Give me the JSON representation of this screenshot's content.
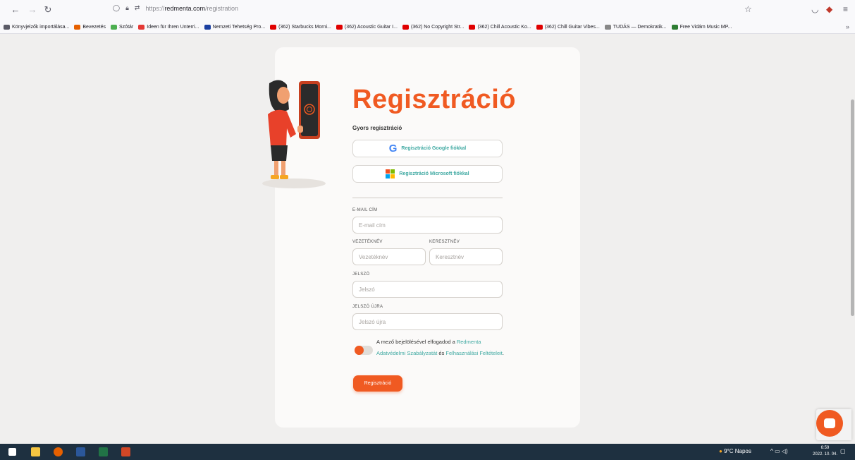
{
  "browser": {
    "url_prefix": "https://",
    "url_host": "redmenta.com",
    "url_path": "/registration",
    "bookmarks": [
      {
        "label": "Könyvjelzők importálása...",
        "color": "#5b5b66"
      },
      {
        "label": "Bevezetés",
        "color": "#e66000"
      },
      {
        "label": "Szótár",
        "color": "#4caf50"
      },
      {
        "label": "Ideen für Ihren Unterri...",
        "color": "#e53935"
      },
      {
        "label": "Nemzeti Tehetség Pro...",
        "color": "#1a3fa0"
      },
      {
        "label": "(362) Starbucks Morni...",
        "color": "#e00000"
      },
      {
        "label": "(362) Acoustic Guitar I...",
        "color": "#e00000"
      },
      {
        "label": "(362) No Copyright Str...",
        "color": "#e00000"
      },
      {
        "label": "(362) Chill Acoustic Ko...",
        "color": "#e00000"
      },
      {
        "label": "(362) Chill Guitar Vibes...",
        "color": "#e00000"
      },
      {
        "label": "TUDÁS — Demokratik...",
        "color": "#888888"
      },
      {
        "label": "Free Vidám Music MP...",
        "color": "#2e7d32"
      }
    ]
  },
  "form": {
    "title": "Regisztráció",
    "subtitle": "Gyors regisztráció",
    "google_button": "Regisztráció Google fiókkal",
    "microsoft_button": "Regisztráció Microsoft fiókkal",
    "email_label": "E-MAIL CÍM",
    "email_placeholder": "E-mail cím",
    "lastname_label": "VEZETÉKNÉV",
    "lastname_placeholder": "Vezetéknév",
    "firstname_label": "KERESZTNÉV",
    "firstname_placeholder": "Keresztnév",
    "password_label": "JELSZÓ",
    "password_placeholder": "Jelszó",
    "password2_label": "JELSZÓ ÚJRA",
    "password2_placeholder": "Jelszó újra",
    "consent_pre": "A mező bejelölésével elfogadod a ",
    "consent_link1": "Redmenta Adatvédelmi Szabályzatát",
    "consent_mid": " és ",
    "consent_link2": "Felhasználási Feltételeit",
    "consent_post": ".",
    "submit": "Regisztráció"
  },
  "taskbar": {
    "weather": "9°C  Napos",
    "time": "6:59",
    "date": "2022. 10. 04."
  },
  "colors": {
    "accent": "#f05a22",
    "link": "#3fa9a2"
  }
}
